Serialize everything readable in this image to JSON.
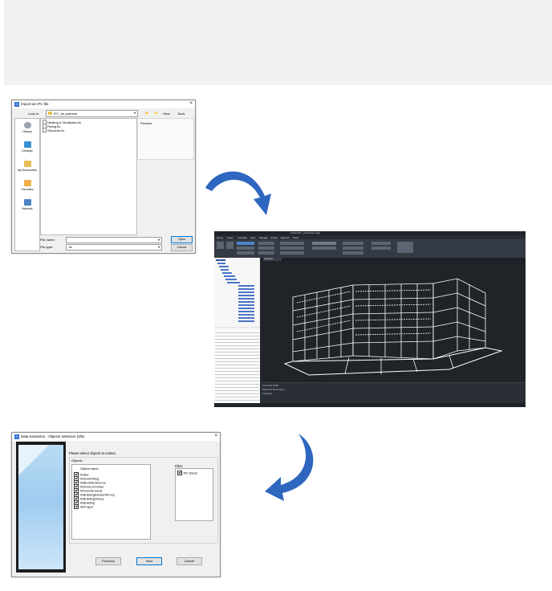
{
  "import_dialog": {
    "title": "Import an IFC file",
    "look_in_label": "Look in:",
    "look_in_value": "IFC_for partners",
    "view_label": "View",
    "tools_label": "Tools",
    "preview_label": "Preview",
    "places": [
      {
        "label": "History",
        "icon": "history-icon"
      },
      {
        "label": "Desktop",
        "icon": "desktop-icon"
      },
      {
        "label": "My Documents",
        "icon": "documents-icon"
      },
      {
        "label": "Favorites",
        "icon": "favorites-icon"
      },
      {
        "label": "Network",
        "icon": "network-icon"
      }
    ],
    "files": [
      "Heating & Ventilation.ifc",
      "Piping.ifc",
      "Structure.ifc"
    ],
    "file_name_label": "File name:",
    "file_name_value": "",
    "file_type_label": "File type:",
    "file_type_value": ".ifc",
    "open_button": "Open",
    "cancel_button": "Cancel"
  },
  "cad": {
    "title": "GstarCAD - [Drawing1.dwg]",
    "menu": [
      "Home",
      "Insert",
      "Annotate",
      "View",
      "Manage",
      "Output",
      "Express",
      "Tools"
    ],
    "tab": "Drawing1",
    "command_lines": [
      "Command: IFCIN",
      "Select IFC file to import...",
      "Command:"
    ]
  },
  "extract_dialog": {
    "title": "Data extraction - Objects selection (3/6)",
    "instruction": "Please select objects to extract.",
    "objects_group": "Objects",
    "column_header": "Object name",
    "objects": [
      "IfcSite",
      "IfcFlowFitting",
      "IfcBlockReference",
      "IfcFlowController",
      "IfcFlowTerminal",
      "IfcBuildingElementProxy",
      "IfcBuildingStorey",
      "IfcBuilding",
      "IfcProject"
    ],
    "filter_label": "Filter",
    "filter_items": [
      "IFC Block"
    ],
    "previous_button": "Previous",
    "next_button": "Next",
    "cancel_button": "Cancel"
  },
  "colors": {
    "arrow": "#2f66c0",
    "cad_background": "#202327",
    "accent": "#0078d7"
  }
}
